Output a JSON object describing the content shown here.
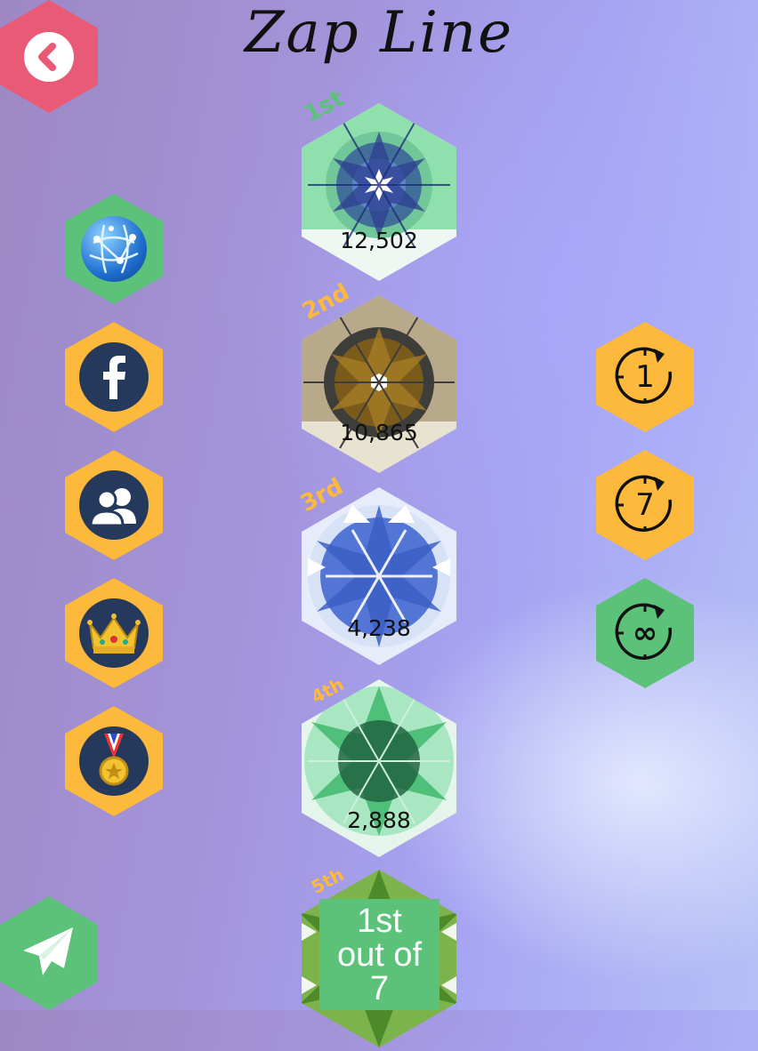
{
  "title": "Zap Line",
  "colors": {
    "back": "#e85a76",
    "orange": "#fdb93b",
    "green": "#5cc179",
    "dark_circle": "#25395d"
  },
  "left_buttons": [
    {
      "icon": "globe-icon"
    },
    {
      "icon": "facebook-icon"
    },
    {
      "icon": "friends-icon"
    },
    {
      "icon": "crown-icon"
    },
    {
      "icon": "medal-icon"
    }
  ],
  "period_buttons": [
    {
      "label": "1"
    },
    {
      "label": "7"
    },
    {
      "label": "∞"
    }
  ],
  "leaderboard": [
    {
      "rank": "1st",
      "score": "12,502"
    },
    {
      "rank": "2nd",
      "score": "10,865"
    },
    {
      "rank": "3rd",
      "score": "4,238"
    },
    {
      "rank": "4th",
      "score": "2,888"
    },
    {
      "rank": "5th",
      "score": ""
    }
  ],
  "player_rank": {
    "line1": "1st",
    "line2": "out of",
    "line3": "7"
  }
}
